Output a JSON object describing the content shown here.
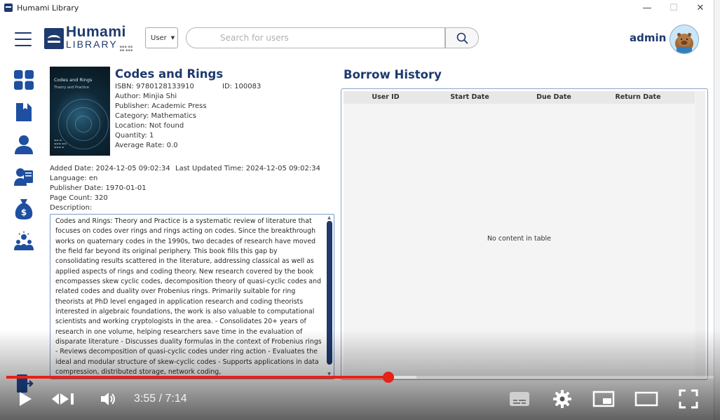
{
  "window": {
    "title": "Humami Library",
    "controls": [
      "—",
      "☐",
      "✕"
    ]
  },
  "header": {
    "logo_top": "Humami",
    "logo_bottom": "LIBRARY",
    "filter_value": "User",
    "search_placeholder": "Search for users",
    "username": "admin"
  },
  "sidebar": {
    "items": [
      {
        "icon": "dashboard-icon"
      },
      {
        "icon": "book-icon"
      },
      {
        "icon": "user-icon"
      },
      {
        "icon": "reader-icon"
      },
      {
        "icon": "money-bag-icon"
      },
      {
        "icon": "community-icon"
      }
    ]
  },
  "book": {
    "title": "Codes and Rings",
    "cover_title": "Codes and Rings",
    "cover_subtitle": "Theory and Practice",
    "isbn": "ISBN: 9780128133910",
    "id": "ID: 100083",
    "author": "Author: Minjia Shi",
    "publisher": "Publisher: Academic Press",
    "category": "Category: Mathematics",
    "location": "Location: Not found",
    "quantity": "Quantity: 1",
    "average_rate": "Average Rate: 0.0",
    "added_date": "Added Date: 2024-12-05 09:02:34",
    "last_updated": "Last Updated Time: 2024-12-05 09:02:34",
    "language": "Language: en",
    "publisher_date": "Publisher Date: 1970-01-01",
    "page_count": "Page Count: 320",
    "description_label": "Description:",
    "description": "Codes and Rings: Theory and Practice is a systematic review of literature that focuses on codes over rings and rings acting on codes. Since the breakthrough works on quaternary codes in the 1990s, two decades of research have moved the field far beyond its original periphery. This book fills this gap by consolidating results scattered in the literature, addressing classical as well as applied aspects of rings and coding theory. New research covered by the book encompasses skew cyclic codes, decomposition theory of quasi-cyclic codes and related codes and duality over Frobenius rings. Primarily suitable for ring theorists at PhD level engaged in application research and coding theorists interested in algebraic foundations, the work is also valuable to computational scientists and working cryptologists in the area. - Consolidates 20+ years of research in one volume, helping researchers save time in the evaluation of disparate literature - Discusses duality formulas in the context of Frobenius rings - Reviews decomposition of quasi-cyclic codes under ring action - Evaluates the ideal and modular structure of skew-cyclic codes - Supports applications in data compression, distributed storage, network coding,"
  },
  "borrow_history": {
    "title": "Borrow History",
    "columns": [
      "User ID",
      "Start Date",
      "Due Date",
      "Return Date"
    ],
    "empty_text": "No content in table"
  },
  "video": {
    "time": "3:55 / 7:14",
    "progress": 0.5397,
    "buffered": 0.58,
    "accent": "#e62117"
  }
}
